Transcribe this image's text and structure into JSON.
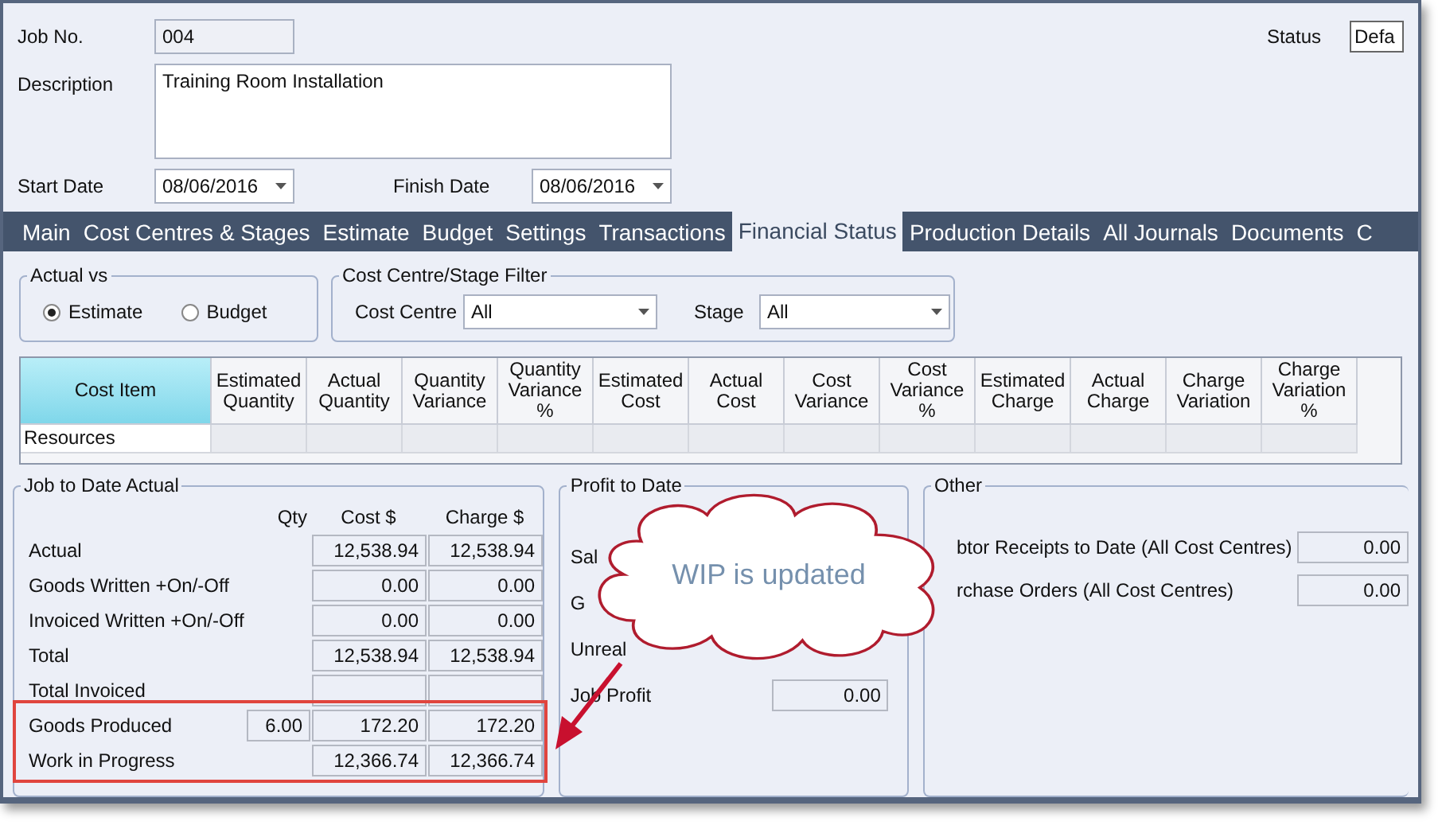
{
  "header": {
    "job_no": {
      "label": "Job No.",
      "value": "004"
    },
    "description": {
      "label": "Description",
      "value": "Training Room Installation"
    },
    "start_date": {
      "label": "Start Date",
      "value": "08/06/2016"
    },
    "finish_date": {
      "label": "Finish Date",
      "value": "08/06/2016"
    },
    "status": {
      "label": "Status",
      "value": "Defa"
    }
  },
  "tabs": [
    {
      "label": "Main",
      "selected": false
    },
    {
      "label": "Cost Centres & Stages",
      "selected": false
    },
    {
      "label": "Estimate",
      "selected": false
    },
    {
      "label": "Budget",
      "selected": false
    },
    {
      "label": "Settings",
      "selected": false
    },
    {
      "label": "Transactions",
      "selected": false
    },
    {
      "label": "Financial Status",
      "selected": true
    },
    {
      "label": "Production Details",
      "selected": false
    },
    {
      "label": "All Journals",
      "selected": false
    },
    {
      "label": "Documents",
      "selected": false
    },
    {
      "label": "C",
      "selected": false
    }
  ],
  "actual_vs": {
    "title": "Actual vs",
    "options": [
      {
        "label": "Estimate",
        "selected": true
      },
      {
        "label": "Budget",
        "selected": false
      }
    ]
  },
  "filter": {
    "title": "Cost Centre/Stage Filter",
    "cost_centre": {
      "label": "Cost Centre",
      "value": "All"
    },
    "stage": {
      "label": "Stage",
      "value": "All"
    }
  },
  "table": {
    "columns": [
      "Cost Item",
      "Estimated Quantity",
      "Actual Quantity",
      "Quantity Variance",
      "Quantity Variance %",
      "Estimated Cost",
      "Actual Cost",
      "Cost Variance",
      "Cost Variance %",
      "Estimated Charge",
      "Actual Charge",
      "Charge Variation",
      "Charge Variation %"
    ],
    "rows": [
      "Resources"
    ]
  },
  "job_to_date": {
    "title": "Job to Date Actual",
    "columns": [
      "Qty",
      "Cost $",
      "Charge $"
    ],
    "rows": [
      {
        "label": "Actual",
        "qty": null,
        "cost": "12,538.94",
        "charge": "12,538.94"
      },
      {
        "label": "Goods Written +On/-Off",
        "qty": null,
        "cost": "0.00",
        "charge": "0.00"
      },
      {
        "label": "Invoiced Written +On/-Off",
        "qty": null,
        "cost": "0.00",
        "charge": "0.00"
      },
      {
        "label": "Total",
        "qty": null,
        "cost": "12,538.94",
        "charge": "12,538.94"
      },
      {
        "label": "Total Invoiced",
        "qty": null,
        "cost": "",
        "charge": ""
      },
      {
        "label": "Goods Produced",
        "qty": "6.00",
        "cost": "172.20",
        "charge": "172.20"
      },
      {
        "label": "Work in Progress",
        "qty": null,
        "cost": "12,366.74",
        "charge": "12,366.74"
      }
    ]
  },
  "profit_to_date": {
    "title": "Profit to Date",
    "rows": [
      {
        "label": "Sal"
      },
      {
        "label": "G"
      },
      {
        "label": "Unreal"
      },
      {
        "label": "Job Profit",
        "value": "0.00"
      }
    ]
  },
  "other": {
    "title": "Other",
    "rows": [
      {
        "label": "btor Receipts to Date (All Cost Centres)",
        "value": "0.00"
      },
      {
        "label": "rchase Orders (All Cost Centres)",
        "value": "0.00"
      }
    ]
  },
  "callout": {
    "text": "WIP is updated"
  }
}
